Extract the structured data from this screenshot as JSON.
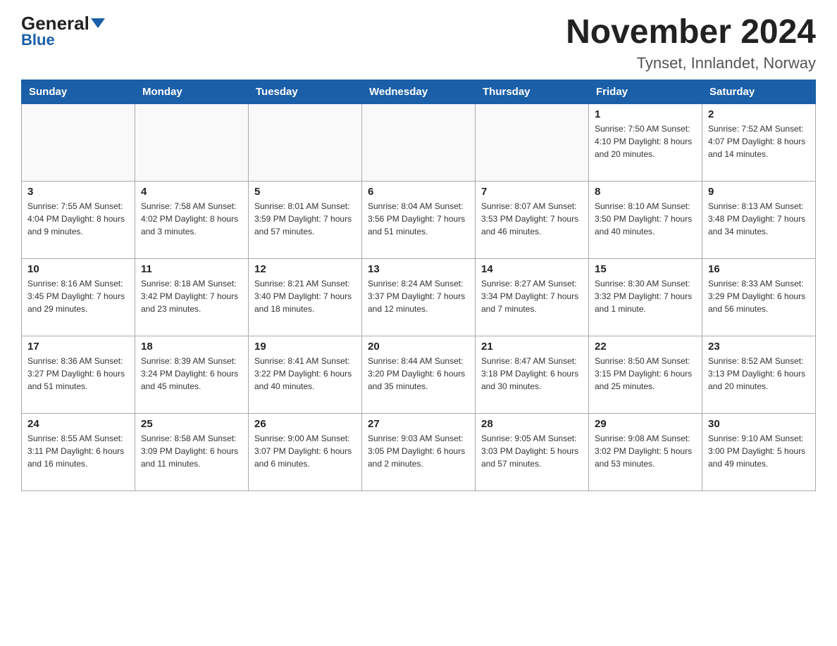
{
  "header": {
    "logo_general": "General",
    "logo_blue": "Blue",
    "month_title": "November 2024",
    "location": "Tynset, Innlandet, Norway"
  },
  "days_of_week": [
    "Sunday",
    "Monday",
    "Tuesday",
    "Wednesday",
    "Thursday",
    "Friday",
    "Saturday"
  ],
  "weeks": [
    [
      {
        "num": "",
        "info": ""
      },
      {
        "num": "",
        "info": ""
      },
      {
        "num": "",
        "info": ""
      },
      {
        "num": "",
        "info": ""
      },
      {
        "num": "",
        "info": ""
      },
      {
        "num": "1",
        "info": "Sunrise: 7:50 AM\nSunset: 4:10 PM\nDaylight: 8 hours\nand 20 minutes."
      },
      {
        "num": "2",
        "info": "Sunrise: 7:52 AM\nSunset: 4:07 PM\nDaylight: 8 hours\nand 14 minutes."
      }
    ],
    [
      {
        "num": "3",
        "info": "Sunrise: 7:55 AM\nSunset: 4:04 PM\nDaylight: 8 hours\nand 9 minutes."
      },
      {
        "num": "4",
        "info": "Sunrise: 7:58 AM\nSunset: 4:02 PM\nDaylight: 8 hours\nand 3 minutes."
      },
      {
        "num": "5",
        "info": "Sunrise: 8:01 AM\nSunset: 3:59 PM\nDaylight: 7 hours\nand 57 minutes."
      },
      {
        "num": "6",
        "info": "Sunrise: 8:04 AM\nSunset: 3:56 PM\nDaylight: 7 hours\nand 51 minutes."
      },
      {
        "num": "7",
        "info": "Sunrise: 8:07 AM\nSunset: 3:53 PM\nDaylight: 7 hours\nand 46 minutes."
      },
      {
        "num": "8",
        "info": "Sunrise: 8:10 AM\nSunset: 3:50 PM\nDaylight: 7 hours\nand 40 minutes."
      },
      {
        "num": "9",
        "info": "Sunrise: 8:13 AM\nSunset: 3:48 PM\nDaylight: 7 hours\nand 34 minutes."
      }
    ],
    [
      {
        "num": "10",
        "info": "Sunrise: 8:16 AM\nSunset: 3:45 PM\nDaylight: 7 hours\nand 29 minutes."
      },
      {
        "num": "11",
        "info": "Sunrise: 8:18 AM\nSunset: 3:42 PM\nDaylight: 7 hours\nand 23 minutes."
      },
      {
        "num": "12",
        "info": "Sunrise: 8:21 AM\nSunset: 3:40 PM\nDaylight: 7 hours\nand 18 minutes."
      },
      {
        "num": "13",
        "info": "Sunrise: 8:24 AM\nSunset: 3:37 PM\nDaylight: 7 hours\nand 12 minutes."
      },
      {
        "num": "14",
        "info": "Sunrise: 8:27 AM\nSunset: 3:34 PM\nDaylight: 7 hours\nand 7 minutes."
      },
      {
        "num": "15",
        "info": "Sunrise: 8:30 AM\nSunset: 3:32 PM\nDaylight: 7 hours\nand 1 minute."
      },
      {
        "num": "16",
        "info": "Sunrise: 8:33 AM\nSunset: 3:29 PM\nDaylight: 6 hours\nand 56 minutes."
      }
    ],
    [
      {
        "num": "17",
        "info": "Sunrise: 8:36 AM\nSunset: 3:27 PM\nDaylight: 6 hours\nand 51 minutes."
      },
      {
        "num": "18",
        "info": "Sunrise: 8:39 AM\nSunset: 3:24 PM\nDaylight: 6 hours\nand 45 minutes."
      },
      {
        "num": "19",
        "info": "Sunrise: 8:41 AM\nSunset: 3:22 PM\nDaylight: 6 hours\nand 40 minutes."
      },
      {
        "num": "20",
        "info": "Sunrise: 8:44 AM\nSunset: 3:20 PM\nDaylight: 6 hours\nand 35 minutes."
      },
      {
        "num": "21",
        "info": "Sunrise: 8:47 AM\nSunset: 3:18 PM\nDaylight: 6 hours\nand 30 minutes."
      },
      {
        "num": "22",
        "info": "Sunrise: 8:50 AM\nSunset: 3:15 PM\nDaylight: 6 hours\nand 25 minutes."
      },
      {
        "num": "23",
        "info": "Sunrise: 8:52 AM\nSunset: 3:13 PM\nDaylight: 6 hours\nand 20 minutes."
      }
    ],
    [
      {
        "num": "24",
        "info": "Sunrise: 8:55 AM\nSunset: 3:11 PM\nDaylight: 6 hours\nand 16 minutes."
      },
      {
        "num": "25",
        "info": "Sunrise: 8:58 AM\nSunset: 3:09 PM\nDaylight: 6 hours\nand 11 minutes."
      },
      {
        "num": "26",
        "info": "Sunrise: 9:00 AM\nSunset: 3:07 PM\nDaylight: 6 hours\nand 6 minutes."
      },
      {
        "num": "27",
        "info": "Sunrise: 9:03 AM\nSunset: 3:05 PM\nDaylight: 6 hours\nand 2 minutes."
      },
      {
        "num": "28",
        "info": "Sunrise: 9:05 AM\nSunset: 3:03 PM\nDaylight: 5 hours\nand 57 minutes."
      },
      {
        "num": "29",
        "info": "Sunrise: 9:08 AM\nSunset: 3:02 PM\nDaylight: 5 hours\nand 53 minutes."
      },
      {
        "num": "30",
        "info": "Sunrise: 9:10 AM\nSunset: 3:00 PM\nDaylight: 5 hours\nand 49 minutes."
      }
    ]
  ]
}
